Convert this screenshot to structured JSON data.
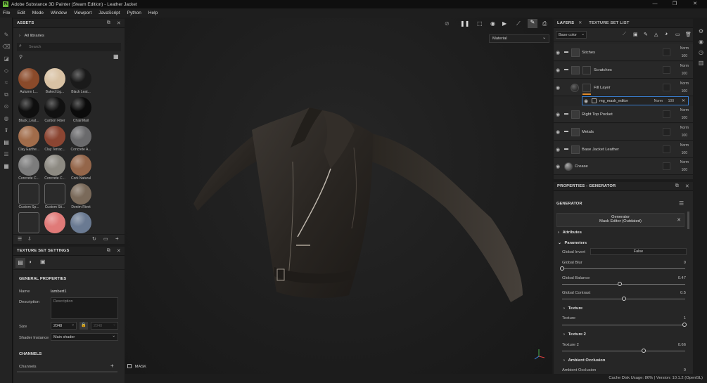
{
  "window": {
    "title": "Adobe Substance 3D Painter (Steam Edition) - Leather Jacket",
    "logo_text": "Pt",
    "controls": [
      "—",
      "❐",
      "✕"
    ]
  },
  "menu": [
    "File",
    "Edit",
    "Mode",
    "Window",
    "Viewport",
    "JavaScript",
    "Python",
    "Help"
  ],
  "assets": {
    "title": "ASSETS",
    "breadcrumb": "All libraries",
    "search_placeholder": "Search",
    "items": [
      {
        "label": "Autumn L...",
        "color": "#8a4a2a"
      },
      {
        "label": "Baked Lig...",
        "color": "#d9c2a4"
      },
      {
        "label": "Black Leat...",
        "color": "#1a1a1a"
      },
      {
        "label": "Black_Leat...",
        "color": "#0f0f0f"
      },
      {
        "label": "Carbon Fiber",
        "color": "#111111"
      },
      {
        "label": "ChainMail",
        "color": "#0b0b0b"
      },
      {
        "label": "Clay Earthe...",
        "color": "#a16c4a"
      },
      {
        "label": "Clay Terrac...",
        "color": "#8b4532"
      },
      {
        "label": "Concrete A...",
        "color": "#6a6a6c"
      },
      {
        "label": "Concrete C...",
        "color": "#7c7c7c"
      },
      {
        "label": "Concrete C...",
        "color": "#8d8a82"
      },
      {
        "label": "Cork Natural",
        "color": "#94664a"
      },
      {
        "label": "Custom Sp...",
        "color": "#dddddd"
      },
      {
        "label": "Custom Sti...",
        "color": "#dddddd"
      },
      {
        "label": "Denim Rivet",
        "color": "#7a6a5a"
      },
      {
        "label": "",
        "color": "#dddddd"
      },
      {
        "label": "",
        "color": "#e07a78"
      },
      {
        "label": "",
        "color": "#6a7a92"
      }
    ]
  },
  "texture_set_settings": {
    "title": "TEXTURE SET SETTINGS",
    "general_title": "GENERAL PROPERTIES",
    "name_label": "Name",
    "name_value": "lambert1",
    "description_label": "Description",
    "description_placeholder": "Description",
    "size_label": "Size",
    "size_value": "2048",
    "size_value2": "2048",
    "shader_label": "Shader Instance",
    "shader_value": "Main shader",
    "channels_title": "CHANNELS",
    "channels_label": "Channels"
  },
  "viewport": {
    "material_select": "Material",
    "mask_label": "MASK"
  },
  "layers": {
    "tab_layers": "LAYERS",
    "tab_texture_set": "TEXTURE SET LIST",
    "channel_select": "Base color",
    "rows": [
      {
        "name": "Stiches",
        "blend": "Norm",
        "opacity": "100",
        "type": "folder"
      },
      {
        "name": "Scratches",
        "blend": "Norm",
        "opacity": "100",
        "type": "folder"
      },
      {
        "name": "Fill Layer",
        "blend": "Norm",
        "opacity": "100",
        "type": "fill"
      },
      {
        "name": "mg_mask_editor",
        "blend": "Norm",
        "opacity": "100",
        "type": "effect"
      },
      {
        "name": "Right Top Pocket",
        "blend": "Norm",
        "opacity": "100",
        "type": "folder"
      },
      {
        "name": "Metals",
        "blend": "Norm",
        "opacity": "100",
        "type": "folder"
      },
      {
        "name": "Base Jacket Leather",
        "blend": "Norm",
        "opacity": "100",
        "type": "folder"
      },
      {
        "name": "Crease",
        "blend": "Norm",
        "opacity": "100",
        "type": "layer"
      }
    ]
  },
  "properties": {
    "title": "PROPERTIES - GENERATOR",
    "section": "GENERATOR",
    "generator_name": "Generator",
    "generator_sub": "Mask Editor (Outdated)",
    "attributes": "Attributes",
    "parameters": "Parameters",
    "global_invert_label": "Global Invert",
    "global_invert_value": "False",
    "global_blur_label": "Global Blur",
    "global_blur_value": "0",
    "global_balance_label": "Global Balance",
    "global_balance_value": "0.47",
    "global_contrast_label": "Global Contrast",
    "global_contrast_value": "0.5",
    "texture_section": "Texture",
    "texture_label": "Texture",
    "texture_value": "1",
    "texture2_section": "Texture 2",
    "texture2_label": "Texture 2",
    "texture2_value": "0.66",
    "ao_section": "Ambient Occlusion",
    "ao_label": "Ambient Occlusion",
    "ao_value": "0"
  },
  "status": {
    "text": "Cache Disk Usage:   86% | Version: 10.1.2 (OpenGL)"
  },
  "colors": {
    "accent_orange": "#e08a2a",
    "selection_blue": "#3b7fd1"
  }
}
